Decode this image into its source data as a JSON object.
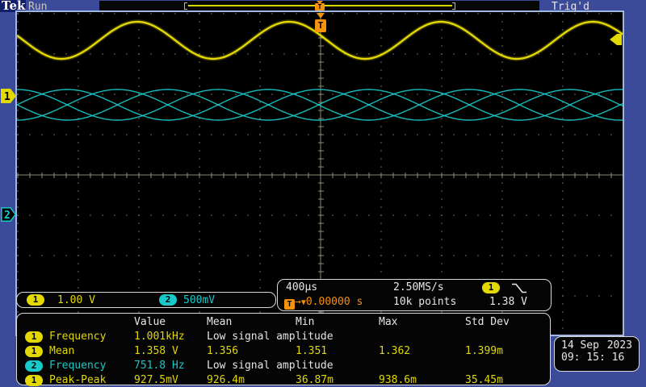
{
  "colors": {
    "background": "#3c4a9a",
    "screen_border": "#9fb8e2",
    "ch1": "#e3d800",
    "ch2": "#18c9c9",
    "trigger": "#f5920e",
    "graticule": "#70705e",
    "text": "#e6e6e6"
  },
  "topbar": {
    "logo": "Tek",
    "acq_status": "Run",
    "trig_status": "Trig'd",
    "record_trigger_marker": "T"
  },
  "screen": {
    "trigger_flag_label": "T",
    "ch1_marker_label": "1",
    "ch2_marker_label": "2"
  },
  "channel_scale": {
    "ch1_label": "1",
    "ch1_scale": "1.00 V",
    "ch2_label": "2",
    "ch2_scale": "500mV"
  },
  "horizontal": {
    "timebase": "400µs",
    "sample_rate": "2.50MS/s",
    "record_length": "10k points",
    "trigger_source": "1",
    "trigger_t": "T",
    "trigger_delay": "0.00000 s",
    "trigger_level": "1.38 V"
  },
  "datetime": {
    "date": "14 Sep",
    "year": "2023",
    "time": "09: 15: 16"
  },
  "measurements": {
    "columns": [
      "Value",
      "Mean",
      "Min",
      "Max",
      "Std Dev"
    ],
    "rows": [
      {
        "source": "1",
        "name": "Frequency",
        "value": "1.001kHz",
        "note": "Low signal amplitude"
      },
      {
        "source": "1",
        "name": "Mean",
        "value": "1.358 V",
        "mean": "1.356",
        "min": "1.351",
        "max": "1.362",
        "stddev": "1.399m"
      },
      {
        "source": "2",
        "name": "Frequency",
        "value": "751.8 Hz",
        "note": "Low signal amplitude"
      },
      {
        "source": "1",
        "name": "Peak-Peak",
        "value": "927.5mV",
        "mean": "926.4m",
        "min": "36.87m",
        "max": "938.6m",
        "stddev": "35.45m"
      }
    ]
  },
  "waveforms": {
    "ch1": {
      "center_y": 35,
      "amplitude": 23,
      "period": 188,
      "peak_x": 149
    },
    "ch2": {
      "center_y": 115,
      "amplitude": 19,
      "period": 249,
      "phases": [
        0,
        1.5708,
        3.1416,
        4.7124
      ]
    }
  },
  "chart_data": {
    "type": "line",
    "title": "Oscilloscope display: CH1 sine wave and CH2 multi-phase low-amplitude sine traces",
    "x_axis": {
      "timebase_per_div": "400µs",
      "divisions": 10,
      "sample_rate": "2.50MS/s",
      "record_length": "10k points"
    },
    "y_axis": {
      "divisions": 8
    },
    "grid": "dotted graticule with solid center crosshair",
    "series": [
      {
        "name": "CH1",
        "color": "#e3d800",
        "volts_per_div": "1.00 V",
        "frequency_hz": 1001,
        "mean_v": 1.358,
        "peak_to_peak_v": 0.9275,
        "period_divisions": 2.5,
        "shape": "sine"
      },
      {
        "name": "CH2",
        "color": "#18c9c9",
        "volts_per_div": "500mV",
        "frequency_hz": 751.8,
        "period_divisions": 3.33,
        "shape": "sine",
        "overlapping_phase_shifted_traces": 4
      }
    ],
    "trigger": {
      "source": "CH1",
      "slope": "falling",
      "level_v": 1.38,
      "delay_s": 0.0,
      "status": "Trig'd",
      "mode": "Run"
    }
  }
}
